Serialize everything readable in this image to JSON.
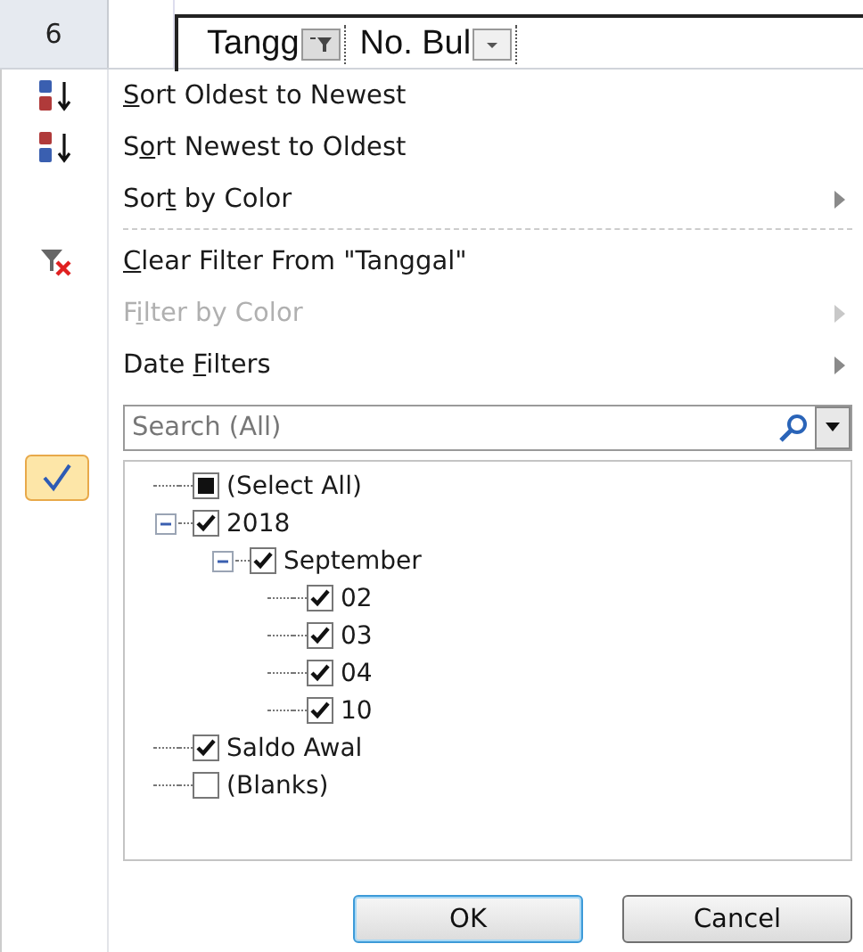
{
  "sheet": {
    "row_number": "6",
    "headers": [
      {
        "label": "Tangg",
        "filtered": true
      },
      {
        "label": "No. Bul",
        "filtered": false
      }
    ]
  },
  "menu": [
    {
      "kind": "sort_ascending",
      "key": "S",
      "post": "ort Oldest to Newest",
      "disabled": false,
      "submenu": false
    },
    {
      "kind": "sort_descending",
      "pre": "S",
      "key": "o",
      "post": "rt Newest to Oldest",
      "disabled": false,
      "submenu": false
    },
    {
      "kind": "command",
      "pre": "Sor",
      "key": "t",
      "post": " by Color",
      "disabled": false,
      "submenu": true
    },
    {
      "kind": "separator"
    },
    {
      "kind": "clear_filter",
      "key": "C",
      "post": "lear Filter From \"Tanggal\"",
      "disabled": false,
      "submenu": false
    },
    {
      "kind": "command",
      "pre": "F",
      "key": "i",
      "post": "lter by Color",
      "disabled": true,
      "submenu": true
    },
    {
      "kind": "command",
      "pre": "Date ",
      "key": "F",
      "post": "ilters",
      "disabled": false,
      "submenu": true
    }
  ],
  "search": {
    "placeholder": "Search (All)"
  },
  "tree": [
    {
      "label": "(Select All)",
      "checked": true,
      "partial": true
    },
    {
      "label": "2018",
      "checked": true,
      "partial": false,
      "expanded": true,
      "children": [
        {
          "label": "September",
          "checked": true,
          "partial": false,
          "expanded": true,
          "children": [
            {
              "label": "02",
              "checked": true,
              "partial": false
            },
            {
              "label": "03",
              "checked": true,
              "partial": false
            },
            {
              "label": "04",
              "checked": true,
              "partial": false
            },
            {
              "label": "10",
              "checked": true,
              "partial": false
            }
          ]
        }
      ]
    },
    {
      "label": "Saldo Awal",
      "checked": true,
      "partial": false
    },
    {
      "label": "(Blanks)",
      "checked": false,
      "partial": false
    }
  ],
  "buttons": [
    {
      "label": "OK",
      "default": true
    },
    {
      "label": "Cancel",
      "default": false
    }
  ]
}
